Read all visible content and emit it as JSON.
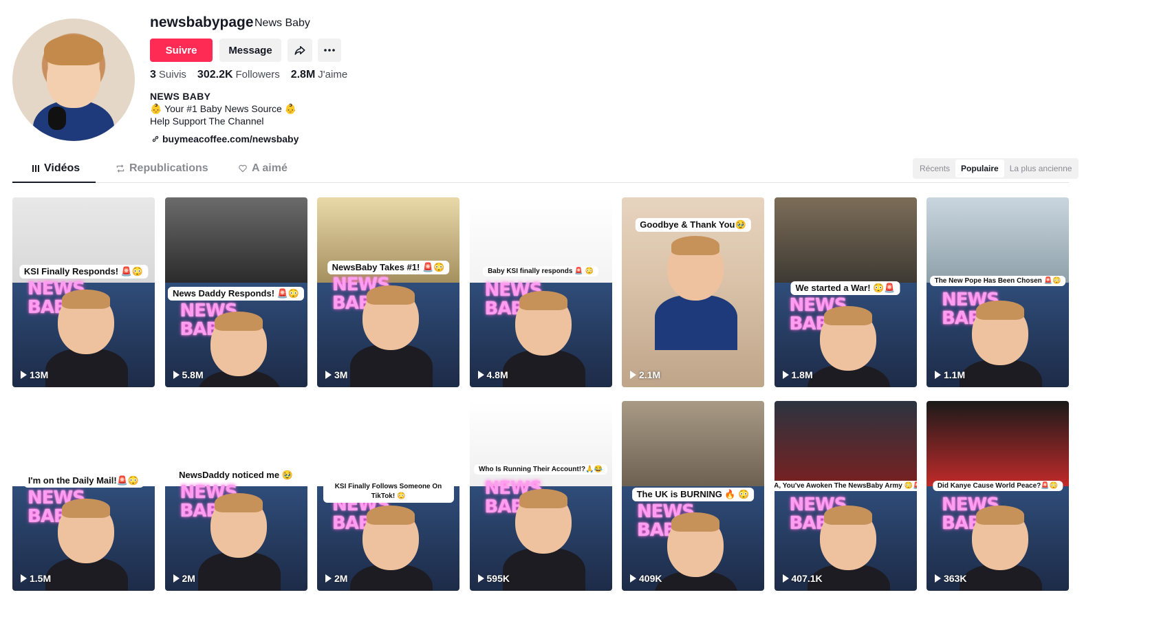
{
  "profile": {
    "username": "newsbabypage",
    "nickname": "News Baby",
    "follow_label": "Suivre",
    "message_label": "Message",
    "stats": [
      {
        "value": "3",
        "label": "Suivis"
      },
      {
        "value": "302.2K",
        "label": "Followers"
      },
      {
        "value": "2.8M",
        "label": "J'aime"
      }
    ],
    "bio_name": "NEWS BABY",
    "bio_line1": "👶 Your #1 Baby News Source 👶",
    "bio_line2": "Help Support The Channel",
    "link": "buymeacoffee.com/newsbaby"
  },
  "tabs": [
    {
      "label": "Vidéos",
      "icon": "grid-icon"
    },
    {
      "label": "Republications",
      "icon": "repost-icon"
    },
    {
      "label": "A aimé",
      "icon": "heart-icon"
    }
  ],
  "sort": [
    "Récents",
    "Populaire",
    "La plus ancienne"
  ],
  "videos": [
    {
      "caption": "KSI Finally Responds! 🚨😳",
      "views": "13M"
    },
    {
      "caption": "News Daddy Responds! 🚨😳",
      "views": "5.8M"
    },
    {
      "caption": "NewsBaby Takes #1! 🚨😳",
      "views": "3M"
    },
    {
      "caption": "Baby KSI finally responds 🚨 😳",
      "views": "4.8M"
    },
    {
      "caption": "Goodbye & Thank You🥹",
      "views": "2.1M"
    },
    {
      "caption": "We started a War! 😳🚨",
      "views": "1.8M"
    },
    {
      "caption": "The New Pope Has Been Chosen 🚨😳",
      "views": "1.1M"
    },
    {
      "caption": "I'm on the Daily Mail!🚨😳",
      "views": "1.5M"
    },
    {
      "caption": "NewsDaddy noticed me 🥹",
      "views": "2M"
    },
    {
      "caption": "KSI Finally Follows Someone On TikTok! 😳",
      "views": "2M"
    },
    {
      "caption": "Who Is Running Their Account!?🙏😂",
      "views": "595K"
    },
    {
      "caption": "The UK is BURNING 🔥 😳",
      "views": "409K"
    },
    {
      "caption": "EA, You've Awoken The NewsBaby Army 😳🚨",
      "views": "407.1K"
    },
    {
      "caption": "Did Kanye Cause World Peace?🚨😳",
      "views": "363K"
    }
  ],
  "neon_text": "NEWS BABY",
  "colors": {
    "accent": "#fe2c55",
    "neon": "#ff9ef0"
  }
}
